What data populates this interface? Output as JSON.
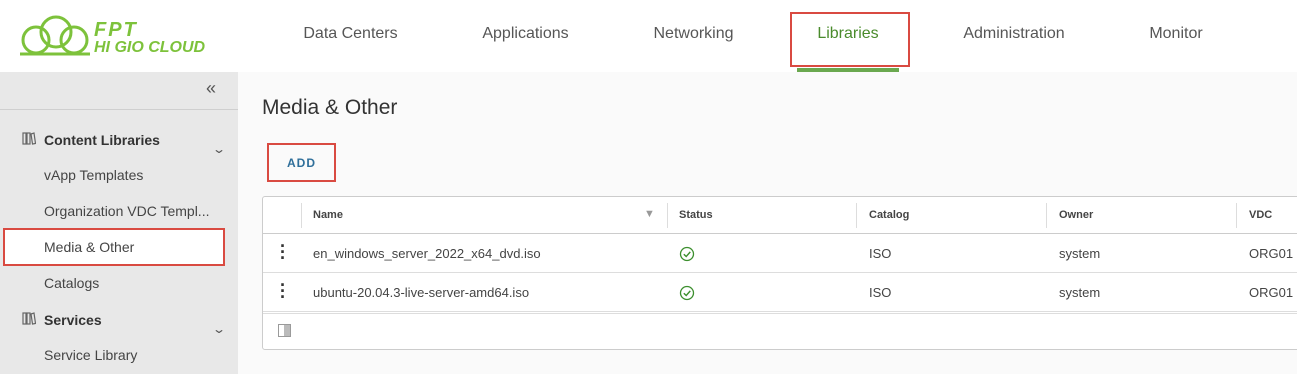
{
  "logo": {
    "line1": "FPT",
    "line2": "HI GIO CLOUD",
    "brand_color": "#7dc23b"
  },
  "nav": {
    "items": [
      {
        "label": "Data Centers"
      },
      {
        "label": "Applications"
      },
      {
        "label": "Networking"
      },
      {
        "label": "Libraries",
        "active": true
      },
      {
        "label": "Administration"
      },
      {
        "label": "Monitor"
      }
    ]
  },
  "sidebar": {
    "collapse_icon": "double-chevron-left-icon",
    "groups": [
      {
        "label": "Content Libraries",
        "icon": "library-icon",
        "items": [
          "vApp Templates",
          "Organization VDC Templ...",
          "Media & Other",
          "Catalogs"
        ]
      },
      {
        "label": "Services",
        "icon": "library-icon",
        "items": [
          "Service Library"
        ]
      }
    ],
    "active_item": "Media & Other"
  },
  "main": {
    "title": "Media & Other",
    "add_label": "ADD",
    "columns": [
      "Name",
      "Status",
      "Catalog",
      "Owner",
      "VDC"
    ],
    "rows": [
      {
        "name": "en_windows_server_2022_x64_dvd.iso",
        "status": "ok",
        "catalog": "ISO",
        "owner": "system",
        "vdc": "ORG01"
      },
      {
        "name": "ubuntu-20.04.3-live-server-amd64.iso",
        "status": "ok",
        "catalog": "ISO",
        "owner": "system",
        "vdc": "ORG01"
      }
    ]
  },
  "colors": {
    "accent_green": "#6aa84f",
    "status_ok": "#3c8f2e",
    "highlight": "#d94a41",
    "link_blue": "#2f6f9a"
  }
}
